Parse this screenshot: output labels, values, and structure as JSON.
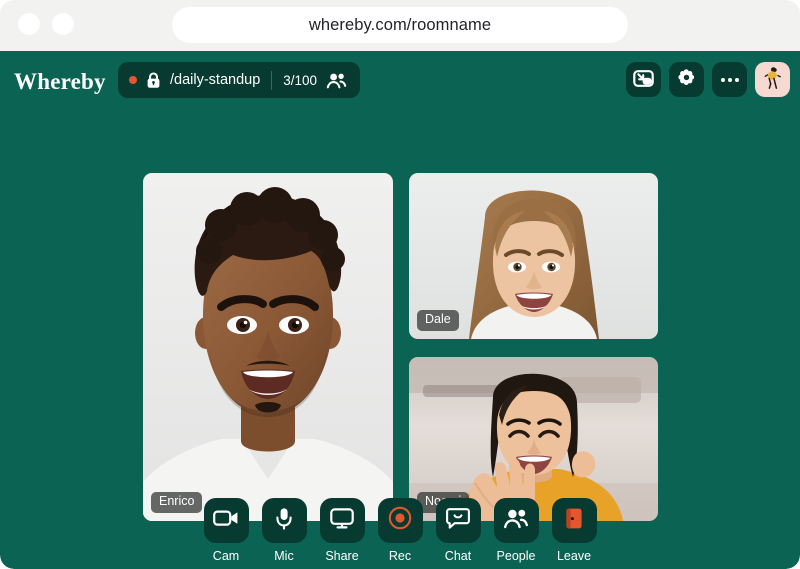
{
  "browser": {
    "url": "whereby.com/roomname",
    "window_dots": [
      "close-dot",
      "minimize-dot"
    ]
  },
  "app": {
    "brand": "Whereby",
    "accent_green": "#0b6354",
    "panel_green": "#073a30",
    "accent_red": "#e4572e",
    "avatar_bg": "#f6d9d0"
  },
  "header": {
    "room": {
      "recording_indicator": "record-dot",
      "lock_icon": "lock-icon",
      "name": "/daily-standup",
      "participant_count": "3/100",
      "people_icon": "people-icon"
    },
    "actions": [
      {
        "name": "picture-in-picture-button",
        "icon": "picture-in-picture-icon"
      },
      {
        "name": "settings-button",
        "icon": "gear-icon"
      },
      {
        "name": "more-options-button",
        "icon": "ellipsis-icon"
      },
      {
        "name": "profile-avatar-button",
        "icon": "avatar-icon"
      }
    ]
  },
  "stage": {
    "tiles": [
      {
        "id": "main",
        "name": "Enrico",
        "role": "speaker"
      },
      {
        "id": "top",
        "name": "Dale",
        "role": "participant"
      },
      {
        "id": "bottom",
        "name": "Noemi",
        "role": "participant"
      }
    ]
  },
  "toolbar": {
    "items": [
      {
        "label": "Cam",
        "icon": "video-camera-icon"
      },
      {
        "label": "Mic",
        "icon": "microphone-icon"
      },
      {
        "label": "Share",
        "icon": "screen-share-icon"
      },
      {
        "label": "Rec",
        "icon": "record-icon"
      },
      {
        "label": "Chat",
        "icon": "chat-bubble-icon"
      },
      {
        "label": "People",
        "icon": "people-icon"
      },
      {
        "label": "Leave",
        "icon": "leave-door-icon"
      }
    ]
  }
}
